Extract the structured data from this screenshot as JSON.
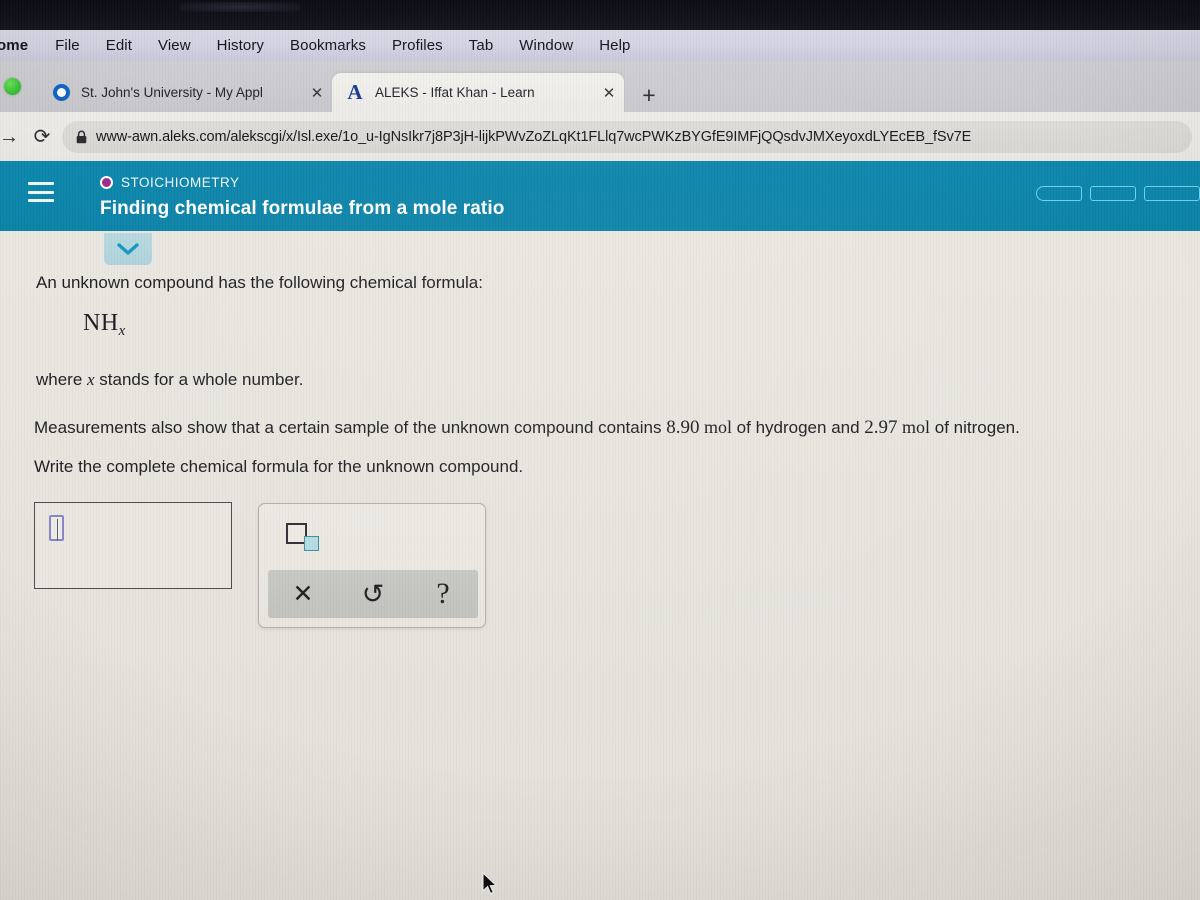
{
  "os": {
    "menubar": [
      {
        "label": "ome",
        "app": true
      },
      {
        "label": "File"
      },
      {
        "label": "Edit"
      },
      {
        "label": "View"
      },
      {
        "label": "History"
      },
      {
        "label": "Bookmarks"
      },
      {
        "label": "Profiles"
      },
      {
        "label": "Tab"
      },
      {
        "label": "Window"
      },
      {
        "label": "Help"
      }
    ]
  },
  "browser": {
    "tabs": [
      {
        "title": "St. John's University - My Appl",
        "icon": "sju-circle-icon",
        "close_label": "✕",
        "active": false
      },
      {
        "title": "ALEKS - Iffat Khan - Learn",
        "icon": "aleks-a-icon",
        "close_label": "✕",
        "active": true
      }
    ],
    "new_tab_label": "+",
    "nav": {
      "forward_label": "→",
      "reload_label": "⟳"
    },
    "omnibox": {
      "lock_icon": "lock-icon",
      "url": "www-awn.aleks.com/alekscgi/x/Isl.exe/1o_u-IgNsIkr7j8P3jH-lijkPWvZoZLqKt1FLlq7wcPWKzBYGfE9IMFjQQsdvJMXeyoxdLYEcEB_fSv7E"
    }
  },
  "aleks": {
    "header": {
      "menu_icon": "hamburger-menu-icon",
      "topic_label": "STOICHIOMETRY",
      "topic_bullet_color": "#9e2a8c",
      "title": "Finding chemical formulae from a mole ratio",
      "accent_color": "#0b86ab",
      "progress_pills": 3
    },
    "collapse_tab": {
      "icon": "chevron-down-icon",
      "glyph": "⌄"
    },
    "question": {
      "line1": "An unknown compound has the following chemical formula:",
      "formula_base": "NH",
      "formula_sub": "x",
      "line2_prefix": "where ",
      "line2_var": "x",
      "line2_suffix": " stands for a whole number.",
      "line3_a": "Measurements also show that a certain sample of the unknown compound contains ",
      "line3_hydrogen": "8.90",
      "line3_b": " mol",
      "line3_c": " of hydrogen and ",
      "line3_nitrogen": "2.97",
      "line3_d": " mol",
      "line3_e": " of nitrogen.",
      "line4": "Write the complete chemical formula for the unknown compound."
    },
    "answer": {
      "input_value": "",
      "caret_name": "empty-math-caret"
    },
    "palette": {
      "subscript_button": "subscript-template-button",
      "buttons": [
        {
          "name": "clear-button",
          "glyph": "✕"
        },
        {
          "name": "undo-button",
          "glyph": "↺"
        },
        {
          "name": "help-button",
          "glyph": "?"
        }
      ]
    }
  },
  "pointer": {
    "name": "mouse-cursor"
  }
}
